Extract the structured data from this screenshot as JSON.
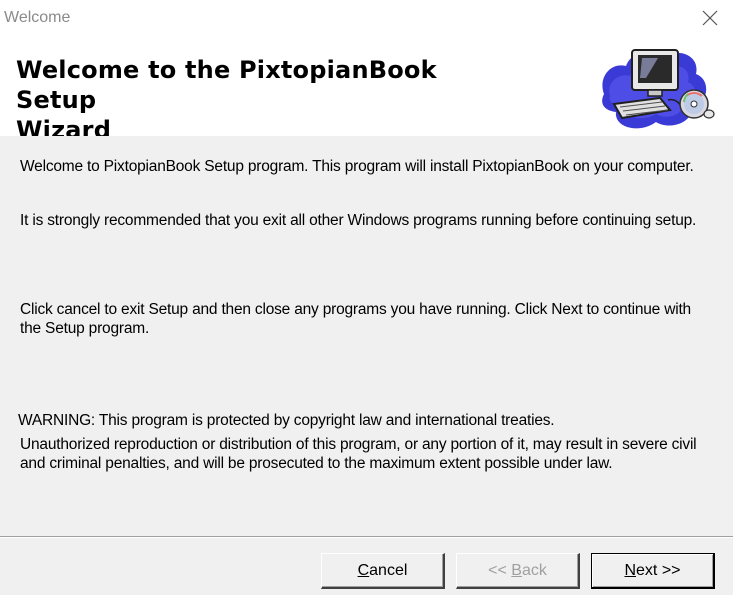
{
  "window": {
    "title": "Welcome",
    "close_glyph": "✕"
  },
  "header": {
    "title_line1": "Welcome to the PixtopianBook Setup",
    "title_line2": "Wizard",
    "art_icon": "computer-cd-icon"
  },
  "body": {
    "para1": "Welcome to PixtopianBook Setup program. This program will install PixtopianBook on your computer.",
    "para2": "It is strongly recommended that you exit all other Windows programs running before continuing setup.",
    "para3": "Click cancel to exit Setup and then close any programs you have running. Click Next to continue with the Setup program.",
    "warning": "WARNING: This program is protected by copyright law and international treaties.",
    "warning_detail": "Unauthorized reproduction or distribution of this program, or any portion of it, may result in severe civil and criminal penalties, and will be prosecuted to the maximum extent possible under law."
  },
  "buttons": {
    "cancel_mnemonic": "C",
    "cancel_rest": "ancel",
    "back_prefix": "<< ",
    "back_mnemonic": "B",
    "back_rest": "ack",
    "next_mnemonic": "N",
    "next_rest": "ext >>"
  },
  "colors": {
    "content_bg": "#f0f0f0",
    "header_bg": "#ffffff",
    "disabled_text": "#a0a0a0"
  }
}
